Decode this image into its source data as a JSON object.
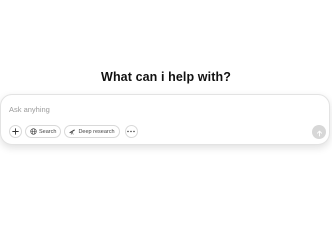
{
  "headline": "What can i help with?",
  "composer": {
    "placeholder": "Ask anyhing",
    "value": "",
    "toolbar": {
      "add_icon": "plus-icon",
      "search_label": "Search",
      "search_icon": "globe-icon",
      "deep_research_label": "Deep research",
      "deep_research_icon": "telescope-icon",
      "more_icon": "more-dots-icon"
    },
    "send_icon": "arrow-up-icon"
  },
  "colors": {
    "background": "#ffffff",
    "border": "#e3e3e3",
    "send_disabled": "#d7d7d7"
  }
}
